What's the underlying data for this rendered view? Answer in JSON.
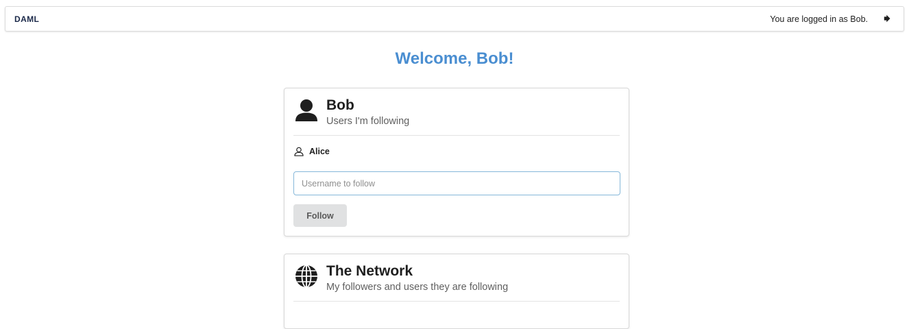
{
  "topbar": {
    "logo": "DAML",
    "logged_in_text": "You are logged in as Bob.",
    "logout_icon": "sign-out-icon"
  },
  "welcome": {
    "title": "Welcome, Bob!",
    "color": "#4a8ed1"
  },
  "following_card": {
    "icon": "user-icon",
    "title": "Bob",
    "subtitle": "Users I'm following",
    "items": [
      {
        "icon": "user-outline-icon",
        "name": "Alice"
      }
    ],
    "input": {
      "value": "",
      "placeholder": "Username to follow"
    },
    "button_label": "Follow"
  },
  "network_card": {
    "icon": "globe-icon",
    "title": "The Network",
    "subtitle": "My followers and users they are following"
  }
}
